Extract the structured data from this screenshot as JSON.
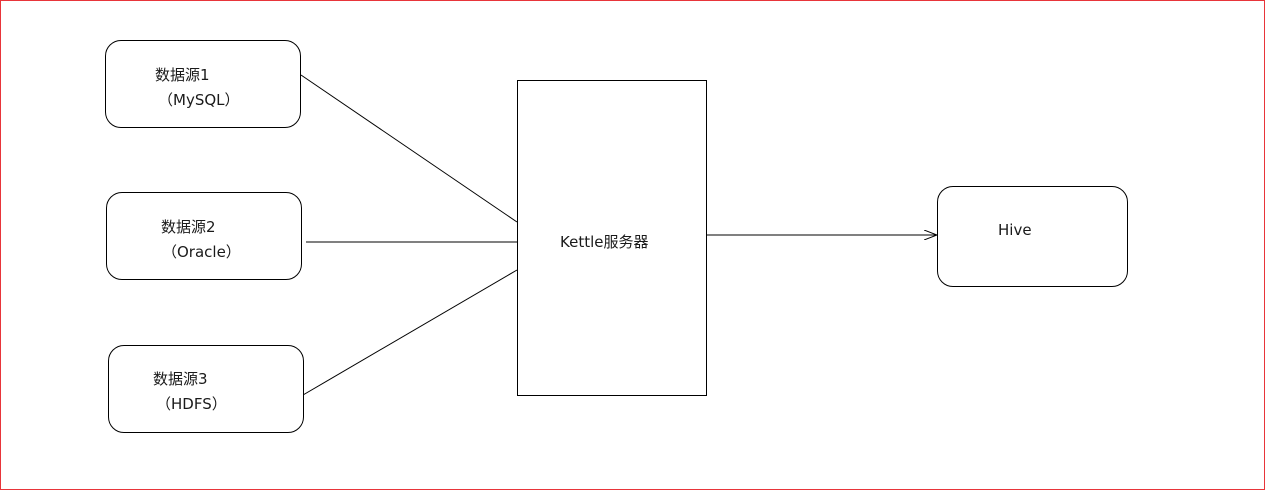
{
  "colors": {
    "frame_border": "#e8353a",
    "stroke": "#000000",
    "text": "#1a1a1a",
    "background": "#ffffff"
  },
  "sources": [
    {
      "name": "数据源1",
      "type": "（MySQL）"
    },
    {
      "name": "数据源2",
      "type": "（Oracle）"
    },
    {
      "name": "数据源3",
      "type": "（HDFS）"
    }
  ],
  "server": {
    "label": "Kettle服务器"
  },
  "target": {
    "label": "Hive"
  }
}
